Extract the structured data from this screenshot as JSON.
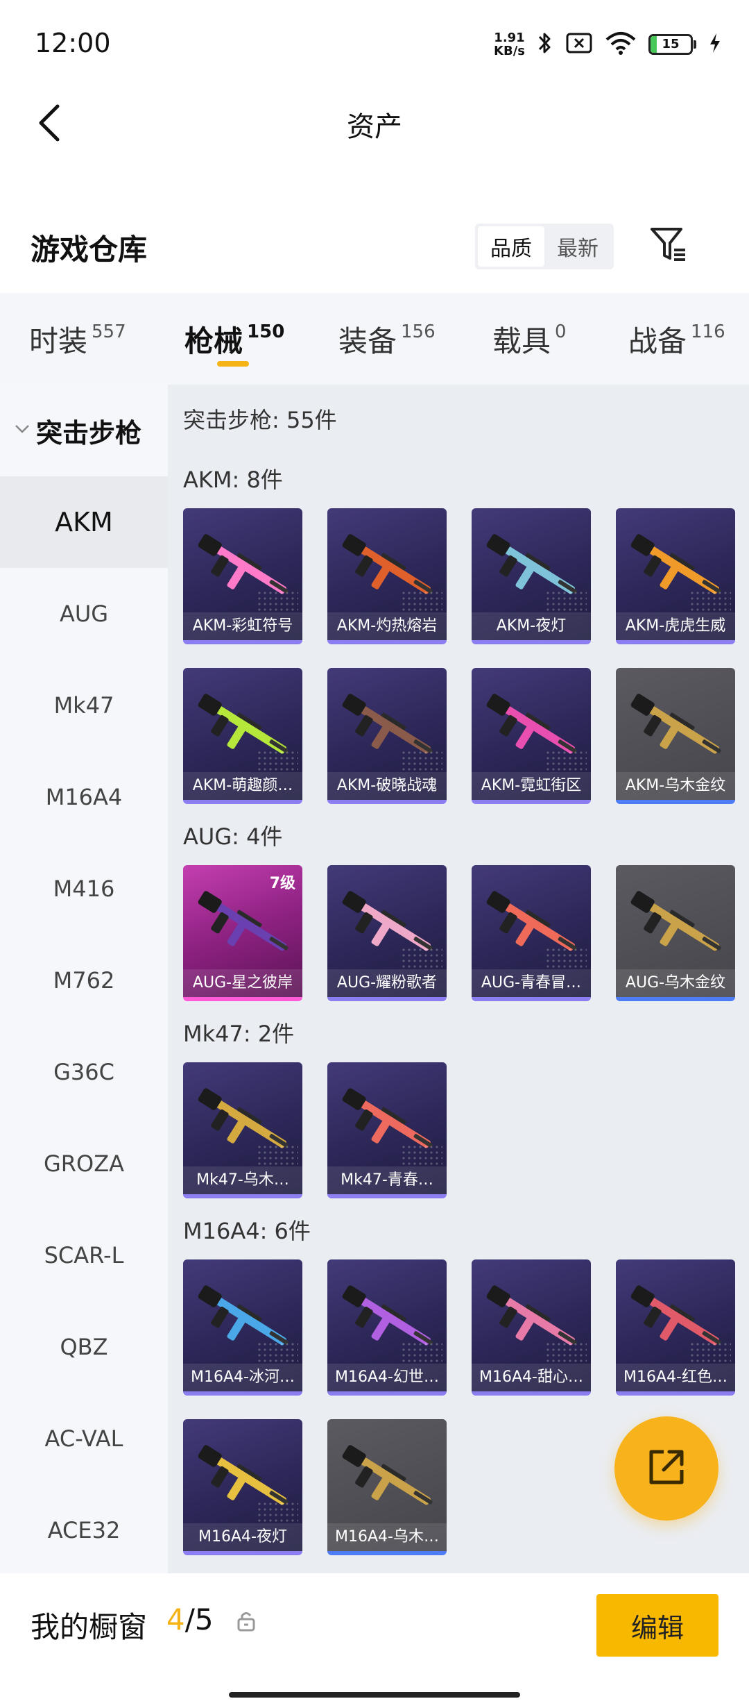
{
  "status_bar": {
    "time": "12:00",
    "net_speed_value": "1.91",
    "net_speed_unit": "KB/s",
    "battery": "15",
    "battery_level": 0.15
  },
  "header": {
    "title": "资产"
  },
  "warehouse": {
    "title": "游戏仓库",
    "sort_options": [
      "品质",
      "最新"
    ],
    "active_sort": "品质"
  },
  "category_tabs": [
    {
      "label": "时装",
      "count": "557"
    },
    {
      "label": "枪械",
      "count": "150"
    },
    {
      "label": "装备",
      "count": "156"
    },
    {
      "label": "载具",
      "count": "0"
    },
    {
      "label": "战备",
      "count": "116"
    }
  ],
  "active_tab": "枪械",
  "sidebar": {
    "group": "突击步枪",
    "items": [
      "AKM",
      "AUG",
      "Mk47",
      "M16A4",
      "M416",
      "M762",
      "G36C",
      "GROZA",
      "SCAR-L",
      "QBZ",
      "AC-VAL",
      "ACE32"
    ],
    "active": "AKM"
  },
  "content": {
    "header": "突击步枪: 55件",
    "sections": [
      {
        "label": "AKM: 8件",
        "items": [
          {
            "name": "AKM-彩虹符号",
            "style": "purple",
            "gun_color": "#ff7ac8"
          },
          {
            "name": "AKM-灼热熔岩",
            "style": "purple",
            "gun_color": "#e0602c"
          },
          {
            "name": "AKM-夜灯",
            "style": "purple",
            "gun_color": "#7fc3d8"
          },
          {
            "name": "AKM-虎虎生威",
            "style": "purple",
            "gun_color": "#f09a2a"
          },
          {
            "name": "AKM-萌趣颜…",
            "style": "purple",
            "gun_color": "#b5e83a"
          },
          {
            "name": "AKM-破晓战魂",
            "style": "purple",
            "gun_color": "#8a5a4a"
          },
          {
            "name": "AKM-霓虹街区",
            "style": "purple",
            "gun_color": "#e84fae"
          },
          {
            "name": "AKM-乌木金纹",
            "style": "gray",
            "gun_color": "#c9a24a"
          }
        ]
      },
      {
        "label": "AUG: 4件",
        "items": [
          {
            "name": "AUG-星之彼岸",
            "style": "pink",
            "gun_color": "#6a3fb0",
            "level": "7级"
          },
          {
            "name": "AUG-耀粉歌者",
            "style": "purple",
            "gun_color": "#f0a8c8"
          },
          {
            "name": "AUG-青春冒…",
            "style": "purple",
            "gun_color": "#f06a5a"
          },
          {
            "name": "AUG-乌木金纹",
            "style": "gray",
            "gun_color": "#c9a24a"
          }
        ]
      },
      {
        "label": "Mk47: 2件",
        "items": [
          {
            "name": "Mk47-乌木…",
            "style": "purple",
            "gun_color": "#d4aa40"
          },
          {
            "name": "Mk47-青春…",
            "style": "purple",
            "gun_color": "#ee6a5e"
          }
        ]
      },
      {
        "label": "M16A4: 6件",
        "items": [
          {
            "name": "M16A4-冰河…",
            "style": "purple",
            "gun_color": "#4aa8e8"
          },
          {
            "name": "M16A4-幻世…",
            "style": "purple",
            "gun_color": "#b060e0"
          },
          {
            "name": "M16A4-甜心…",
            "style": "purple",
            "gun_color": "#e87aa8"
          },
          {
            "name": "M16A4-红色…",
            "style": "purple",
            "gun_color": "#e05a6a"
          },
          {
            "name": "M16A4-夜灯",
            "style": "purple",
            "gun_color": "#e8c040"
          },
          {
            "name": "M16A4-乌木…",
            "style": "gray",
            "gun_color": "#c9a24a"
          }
        ]
      }
    ]
  },
  "bottom_bar": {
    "label": "我的橱窗",
    "current": "4",
    "separator": "/",
    "total": "5",
    "edit_label": "编辑"
  },
  "colors": {
    "accent": "#f5b316",
    "card_purple": "#2c2757",
    "card_gray": "#4a4a50",
    "card_pink": "#8d2181"
  },
  "icons": {
    "back": "chevron-left-icon",
    "filter": "filter-list-icon",
    "fab": "share-external-icon",
    "lock": "lock-icon",
    "group": "chevron-down-icon"
  }
}
